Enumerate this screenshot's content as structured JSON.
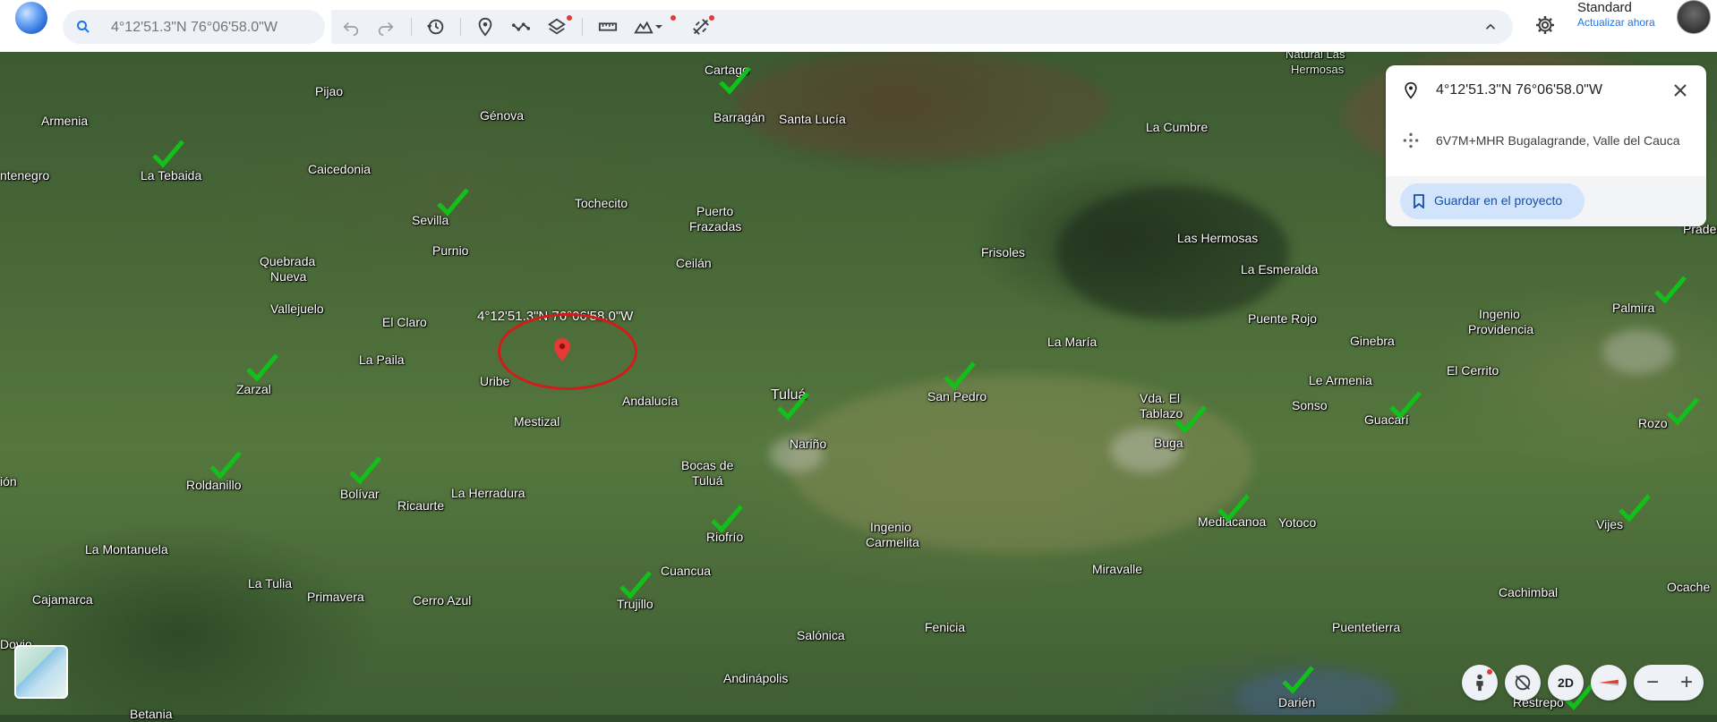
{
  "search": {
    "placeholder": "4°12'51.3\"N 76°06'58.0\"W"
  },
  "account": {
    "map_style": "Standard",
    "update_link": "Actualizar ahora"
  },
  "colors": {
    "accent": "#1a73e8",
    "check": "#11c11a",
    "circle": "#d21b1b",
    "pin": "#e53935"
  },
  "toolbar": {
    "icons": [
      "undo-icon",
      "redo-icon",
      "history-icon",
      "place-pin-icon",
      "path-icon",
      "layers-icon",
      "ruler-icon",
      "terrain-icon",
      "dropdown-caret-icon",
      "satellite-icon",
      "collapse-chevron-icon"
    ]
  },
  "map": {
    "marker_label": "4°12'51.3\"N 76°06'58.0\"W",
    "places": [
      {
        "name": "Cartago"
      },
      {
        "name": "Natural Las"
      },
      {
        "name": "Hermosas"
      },
      {
        "name": "Pijao"
      },
      {
        "name": "Armenia"
      },
      {
        "name": "Génova"
      },
      {
        "name": "Barragán"
      },
      {
        "name": "Santa Lucía"
      },
      {
        "name": "La Cumbre"
      },
      {
        "name": "ntenegro"
      },
      {
        "name": "La Tebaida"
      },
      {
        "name": "Caicedonia"
      },
      {
        "name": "Tochecito"
      },
      {
        "name": "Puerto"
      },
      {
        "name": "Frazadas"
      },
      {
        "name": "Sevilla"
      },
      {
        "name": "Las Hermosas"
      },
      {
        "name": "Prader"
      },
      {
        "name": "Quebrada"
      },
      {
        "name": "Nueva"
      },
      {
        "name": "Purnio"
      },
      {
        "name": "Ceilán"
      },
      {
        "name": "Frisoles"
      },
      {
        "name": "La Esmeralda"
      },
      {
        "name": "Vallejuelo"
      },
      {
        "name": "Palmira"
      },
      {
        "name": "El Claro"
      },
      {
        "name": "Puente Rojo"
      },
      {
        "name": "Ingenio"
      },
      {
        "name": "Providencia"
      },
      {
        "name": "La Paila"
      },
      {
        "name": "La María"
      },
      {
        "name": "Ginebra"
      },
      {
        "name": "Zarzal"
      },
      {
        "name": "Uribe"
      },
      {
        "name": "El Cerrito"
      },
      {
        "name": "Tuluá"
      },
      {
        "name": "San Pedro"
      },
      {
        "name": "Le Armenia"
      },
      {
        "name": "Andalucía"
      },
      {
        "name": "Vda. El"
      },
      {
        "name": "Tablazo"
      },
      {
        "name": "Sonso"
      },
      {
        "name": "Mestizal"
      },
      {
        "name": "Guacarí"
      },
      {
        "name": "Rozo"
      },
      {
        "name": "Nariño"
      },
      {
        "name": "Buga"
      },
      {
        "name": "Bocas de"
      },
      {
        "name": "Tuluá"
      },
      {
        "name": "Roldanillo"
      },
      {
        "name": "ión"
      },
      {
        "name": "Bolívar"
      },
      {
        "name": "La Herradura"
      },
      {
        "name": "Ricaurte"
      },
      {
        "name": "Mediacanoa"
      },
      {
        "name": "Yotoco"
      },
      {
        "name": "Vijes"
      },
      {
        "name": "Riofrío"
      },
      {
        "name": "Ingenio"
      },
      {
        "name": "Carmelita"
      },
      {
        "name": "La Montanuela"
      },
      {
        "name": "Cuancua"
      },
      {
        "name": "Miravalle"
      },
      {
        "name": "La Tulia"
      },
      {
        "name": "Trujillo"
      },
      {
        "name": "Cachimbal"
      },
      {
        "name": "Ocache"
      },
      {
        "name": "Cajamarca"
      },
      {
        "name": "Primavera"
      },
      {
        "name": "Cerro Azul"
      },
      {
        "name": "Fenicia"
      },
      {
        "name": "Puentetierra"
      },
      {
        "name": "Dovio"
      },
      {
        "name": "Salónica"
      },
      {
        "name": "Andinápolis"
      },
      {
        "name": "Darién"
      },
      {
        "name": "Restrepo"
      },
      {
        "name": "Betania"
      }
    ]
  },
  "info_panel": {
    "title": "4°12'51.3\"N 76°06'58.0\"W",
    "plus_code": "6V7M+MHR Bugalagrande, Valle del Cauca",
    "save_button": "Guardar en el proyecto"
  },
  "controls": {
    "view_mode": "2D",
    "zoom_out": "−",
    "zoom_in": "+"
  }
}
